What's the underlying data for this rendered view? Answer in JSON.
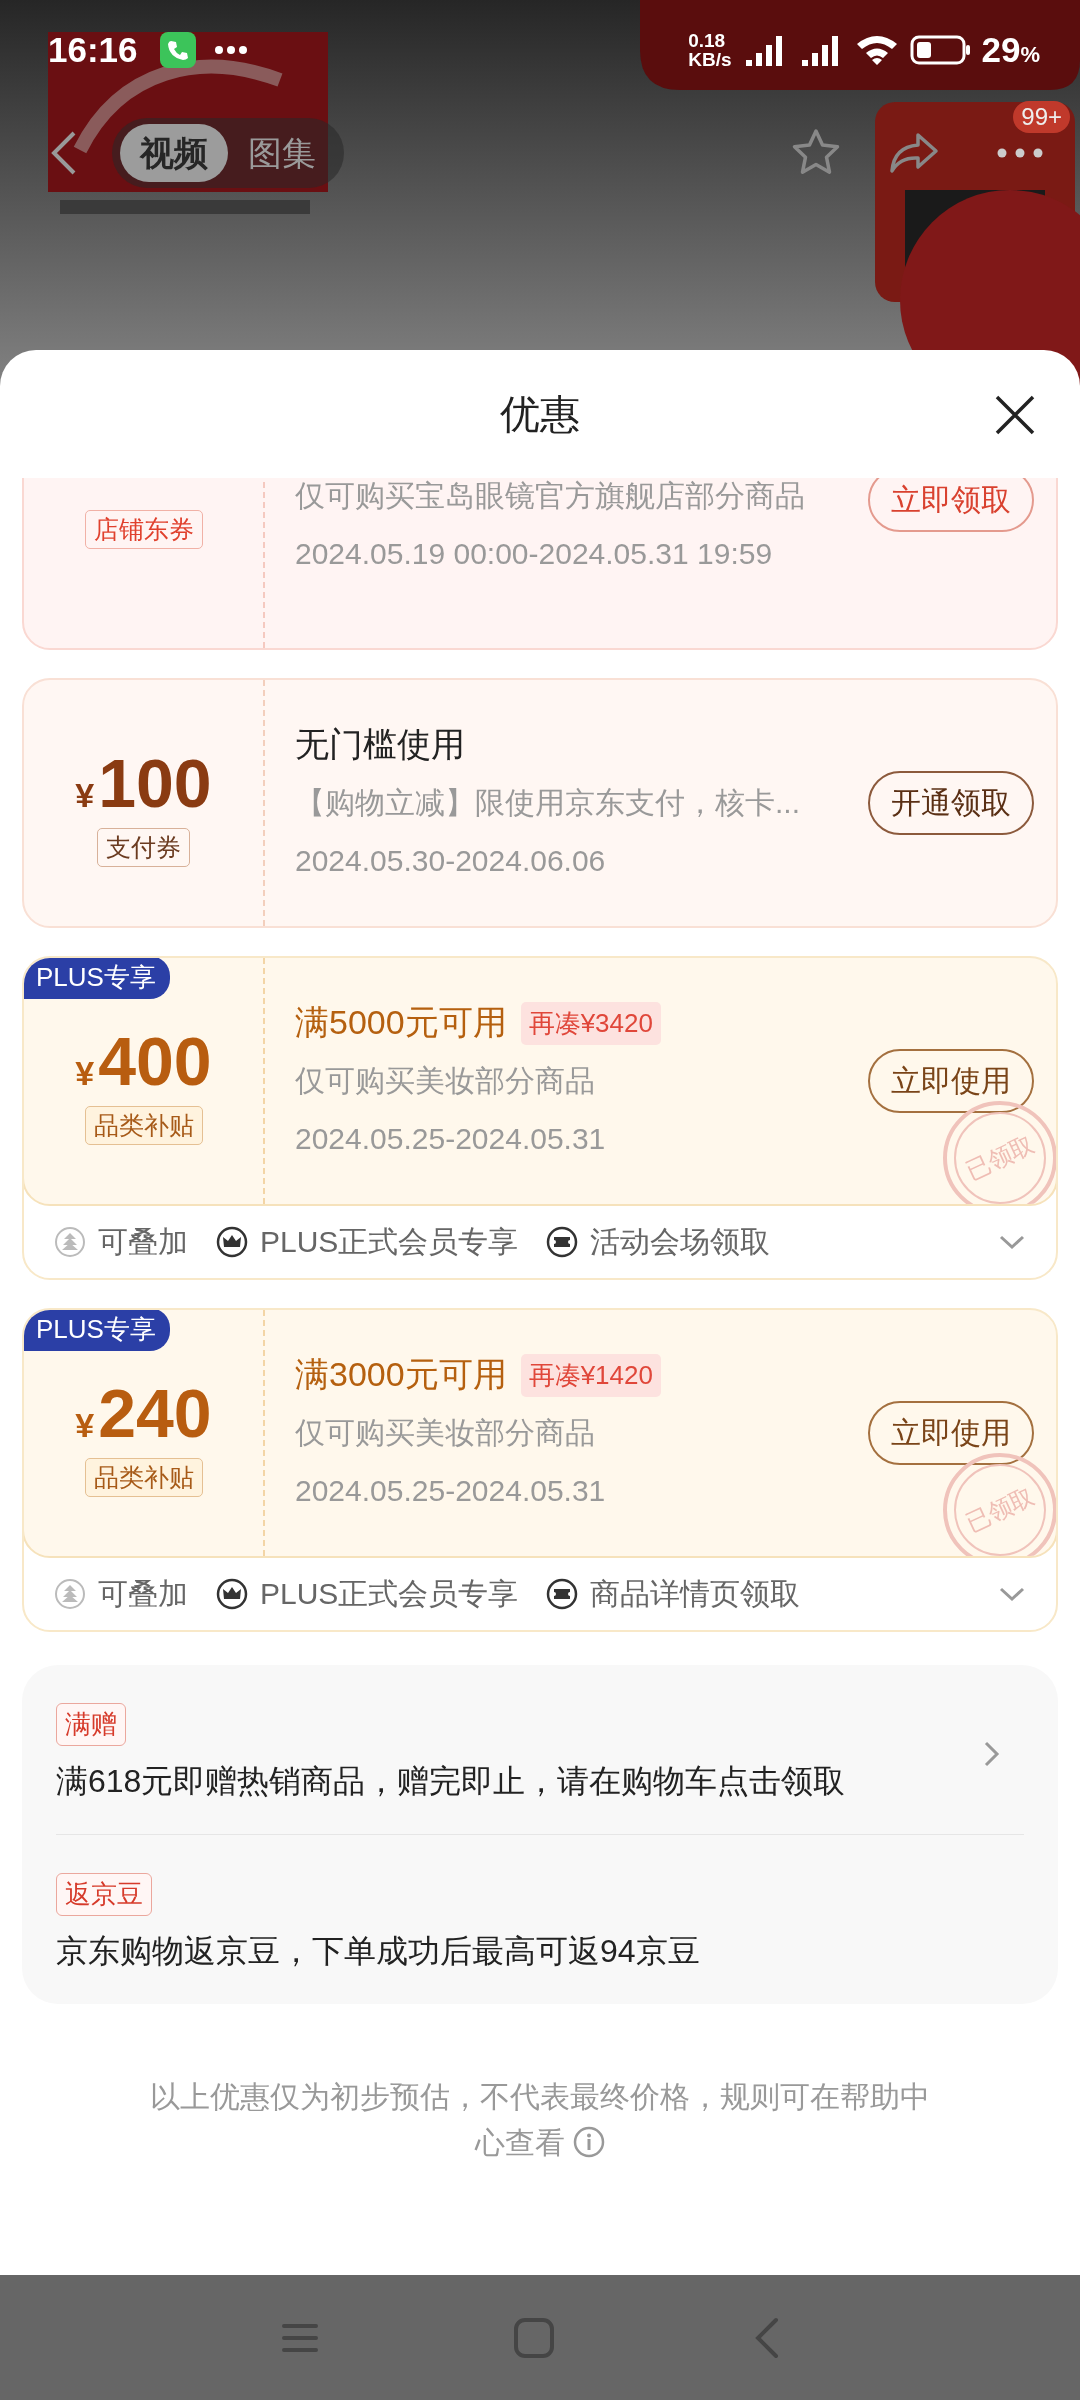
{
  "status_bar": {
    "time": "16:16",
    "net_speed": "0.18",
    "net_unit": "KB/s",
    "battery": "29",
    "battery_unit": "%"
  },
  "top_nav": {
    "tabs": [
      {
        "label": "视频",
        "selected": true
      },
      {
        "label": "图集",
        "selected": false
      }
    ],
    "badge": "99+"
  },
  "sheet": {
    "title": "优惠"
  },
  "coupons": [
    {
      "kind": "store",
      "tag": "店铺东券",
      "desc": "仅可购买宝岛眼镜官方旗舰店部分商品",
      "date": "2024.05.19 00:00-2024.05.31 19:59",
      "button": "立即领取"
    },
    {
      "kind": "payment",
      "currency": "¥",
      "amount": "100",
      "tag": "支付券",
      "title": "无门槛使用",
      "desc": "【购物立减】限使用京东支付，核卡...",
      "date": "2024.05.30-2024.06.06",
      "button": "开通领取"
    },
    {
      "kind": "plus",
      "badge": "PLUS专享",
      "currency": "¥",
      "amount": "400",
      "tag": "品类补贴",
      "title": "满5000元可用",
      "extra": "再凑¥3420",
      "desc": "仅可购买美妆部分商品",
      "date": "2024.05.25-2024.05.31",
      "button": "立即使用",
      "stamp": "已领取",
      "expanded": false,
      "features": [
        {
          "kind": "stack",
          "label": "可叠加"
        },
        {
          "kind": "crown",
          "label": "PLUS正式会员专享"
        },
        {
          "kind": "ticket",
          "label": "活动会场领取"
        }
      ]
    },
    {
      "kind": "plus",
      "badge": "PLUS专享",
      "currency": "¥",
      "amount": "240",
      "tag": "品类补贴",
      "title": "满3000元可用",
      "extra": "再凑¥1420",
      "desc": "仅可购买美妆部分商品",
      "date": "2024.05.25-2024.05.31",
      "button": "立即使用",
      "stamp": "已领取",
      "expanded": false,
      "features": [
        {
          "kind": "stack",
          "label": "可叠加"
        },
        {
          "kind": "crown",
          "label": "PLUS正式会员专享"
        },
        {
          "kind": "ticket",
          "label": "商品详情页领取"
        }
      ]
    }
  ],
  "promotions": [
    {
      "tag": "满赠",
      "text": "满618元即赠热销商品，赠完即止，请在购物车点击领取",
      "has_link": true
    },
    {
      "tag": "返京豆",
      "text": "京东购物返京豆，下单成功后最高可返94京豆",
      "has_link": false
    }
  ],
  "note": {
    "text": "以上优惠仅为初步预估，不代表最终价格，规则可在帮助中心查看"
  }
}
